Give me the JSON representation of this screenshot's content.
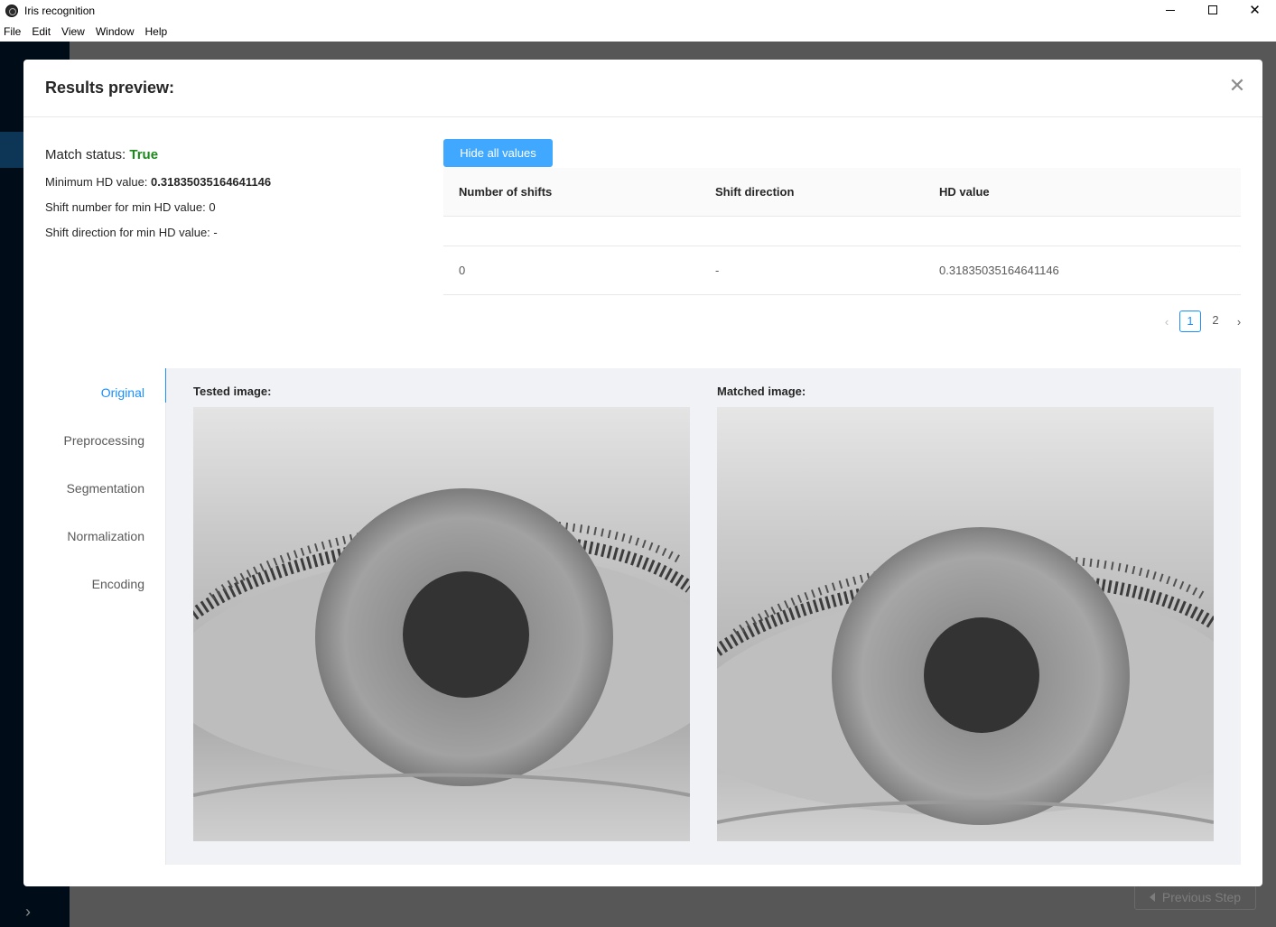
{
  "window": {
    "title": "Iris recognition"
  },
  "menu": [
    "File",
    "Edit",
    "View",
    "Window",
    "Help"
  ],
  "modal": {
    "title": "Results preview:",
    "summary": {
      "match_status_label": "Match status:",
      "match_status_value": "True",
      "min_hd_label": "Minimum HD value:",
      "min_hd_value": "0.31835035164641146",
      "shift_number_label": "Shift number for min HD value:",
      "shift_number_value": "0",
      "shift_direction_label": "Shift direction for min HD value:",
      "shift_direction_value": "-"
    },
    "hide_button": "Hide all values",
    "table": {
      "columns": [
        "Number of shifts",
        "Shift direction",
        "HD value"
      ],
      "rows": [
        {
          "shifts": "0",
          "direction": "-",
          "hd": "0.31835035164641146"
        }
      ]
    },
    "pagination": {
      "pages": [
        "1",
        "2"
      ],
      "current": "1"
    },
    "tabs": [
      "Original",
      "Preprocessing",
      "Segmentation",
      "Normalization",
      "Encoding"
    ],
    "active_tab": "Original",
    "images": {
      "tested_label": "Tested image:",
      "matched_label": "Matched image:"
    }
  },
  "background": {
    "previous_step": "Previous Step"
  },
  "colors": {
    "accent": "#1890ff",
    "button": "#40a9ff",
    "match_true": "#1a8a1a"
  }
}
